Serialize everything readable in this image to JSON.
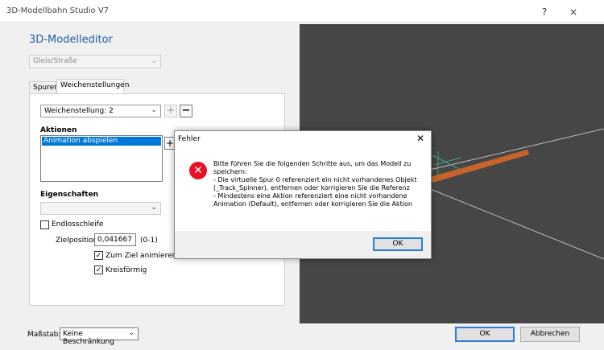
{
  "window": {
    "title": "3D-Modellbahn Studio V7",
    "help_glyph": "?",
    "close_glyph": "×"
  },
  "editor": {
    "title": "3D-Modelleditor",
    "type_select": "Gleis/Straße",
    "tabs": [
      {
        "label": "Spuren"
      },
      {
        "label": "Weichenstellungen"
      }
    ],
    "switch_setting": "Weichenstellung: 2",
    "plus_glyph": "+",
    "minus_glyph": "−",
    "actions_label": "Aktionen",
    "actions": [
      "Animation abspielen"
    ],
    "properties_label": "Eigenschaften",
    "loop_label": "Endlosschleife",
    "loop_checked": false,
    "target_label": "Zielposition:",
    "target_value": "0,041667",
    "target_range": "(0-1)",
    "animate_label": "Zum Ziel animieren",
    "animate_checked": true,
    "circular_label": "Kreisförmig",
    "circular_checked": true,
    "check_glyph": "✓"
  },
  "bottom": {
    "scale_label": "Maßstab:",
    "scale_value": "Keine Beschränkung",
    "ok_label": "OK",
    "cancel_label": "Abbrechen"
  },
  "error_dialog": {
    "title": "Fehler",
    "close_glyph": "✕",
    "icon": "error-x-icon",
    "icon_glyph": "✕",
    "message": "Bitte führen Sie die folgenden Schritte aus, um das Modell zu speichern:\n- Die virtuelle Spur 0 referenziert ein nicht vorhandenes Objekt (_Track_Spinner), entfernen oder korrigieren Sie die Referenz\n- Mindestens eine Aktion referenziert eine nicht vorhandene Animation (Default), entfernen oder korrigieren Sie die Aktion",
    "ok_label": "OK"
  },
  "colors": {
    "accent": "#0078d7",
    "title_blue": "#1f5fa8",
    "viewport_bg": "#464646",
    "error_red": "#e81123",
    "track_orange": "#c8642a"
  }
}
